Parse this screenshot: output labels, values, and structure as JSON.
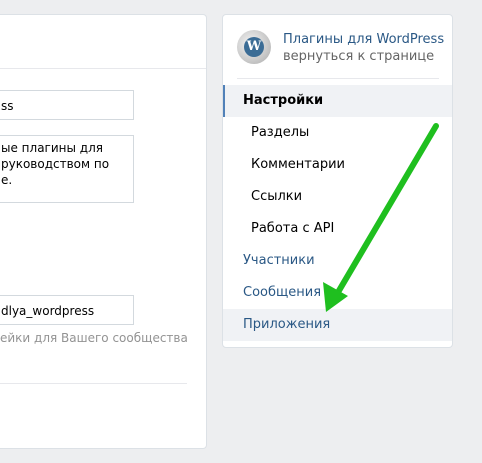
{
  "main": {
    "fields": [
      {
        "value": "ss"
      },
      {
        "value": "ые плагины для руководством по е."
      },
      {
        "value": "dlya_wordpress"
      }
    ],
    "hint": "ейки для Вашего сообщества"
  },
  "sidebar": {
    "group_name": "Плагины для WordPress",
    "back_link": "вернуться к странице",
    "avatar_letter": "W",
    "menu": [
      {
        "label": "Настройки"
      },
      {
        "label": "Разделы"
      },
      {
        "label": "Комментарии"
      },
      {
        "label": "Ссылки"
      },
      {
        "label": "Работа с API"
      },
      {
        "label": "Участники"
      },
      {
        "label": "Сообщения"
      },
      {
        "label": "Приложения"
      }
    ]
  },
  "colors": {
    "link": "#2a5885",
    "accent": "#5181b8",
    "arrow": "#1fbf1f"
  },
  "icons": {
    "avatar": "wordpress-logo-icon",
    "annotation": "green-arrow-icon"
  }
}
